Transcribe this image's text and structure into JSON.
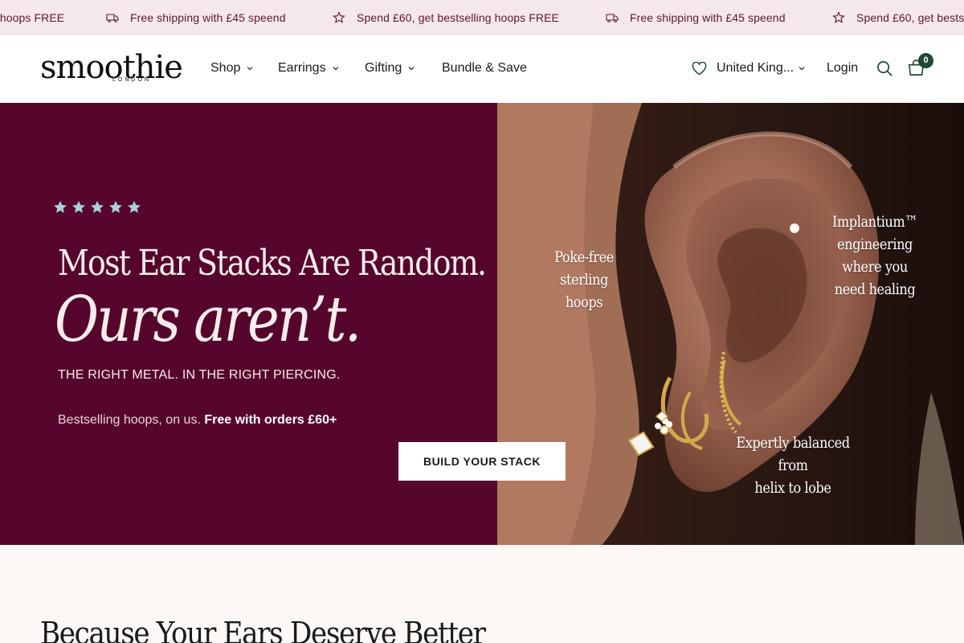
{
  "announcement": {
    "items": [
      {
        "icon": "star-icon",
        "text": "Spend £60, get bestselling hoops FREE"
      },
      {
        "icon": "truck-icon",
        "text": "Free shipping with £45 speend"
      }
    ],
    "partial_first": "g hoops FREE"
  },
  "header": {
    "logo_text": "smoothie",
    "logo_sub": "LONDON",
    "nav": [
      {
        "label": "Shop",
        "has_dropdown": true
      },
      {
        "label": "Earrings",
        "has_dropdown": true
      },
      {
        "label": "Gifting",
        "has_dropdown": true
      },
      {
        "label": "Bundle & Save",
        "has_dropdown": false
      }
    ],
    "country_label": "United King...",
    "login_label": "Login",
    "cart_count": "0"
  },
  "hero": {
    "rating_stars": 5,
    "headline": "Most Ear Stacks Are Random.",
    "headline_italic": "Ours aren’t.",
    "subhead": "THE RIGHT METAL.  IN THE RIGHT PIERCING.",
    "note_prefix": "Bestselling hoops, on us.",
    "note_bold": "Free with orders £60+",
    "cta_label": "BUILD YOUR STACK",
    "ear_labels": {
      "left": [
        "Poke-free",
        "sterling",
        "hoops"
      ],
      "right": [
        "Implantium™",
        "engineering",
        "where you",
        "need healing"
      ],
      "bottom": [
        "Expertly balanced from",
        "helix to lobe"
      ]
    }
  },
  "section": {
    "title": "Because Your Ears Deserve Better"
  },
  "colors": {
    "announcement_bg": "#f5e8ea",
    "hero_bg": "#56062c",
    "cart_badge": "#1f4a33",
    "star": "#a8d0dc"
  }
}
